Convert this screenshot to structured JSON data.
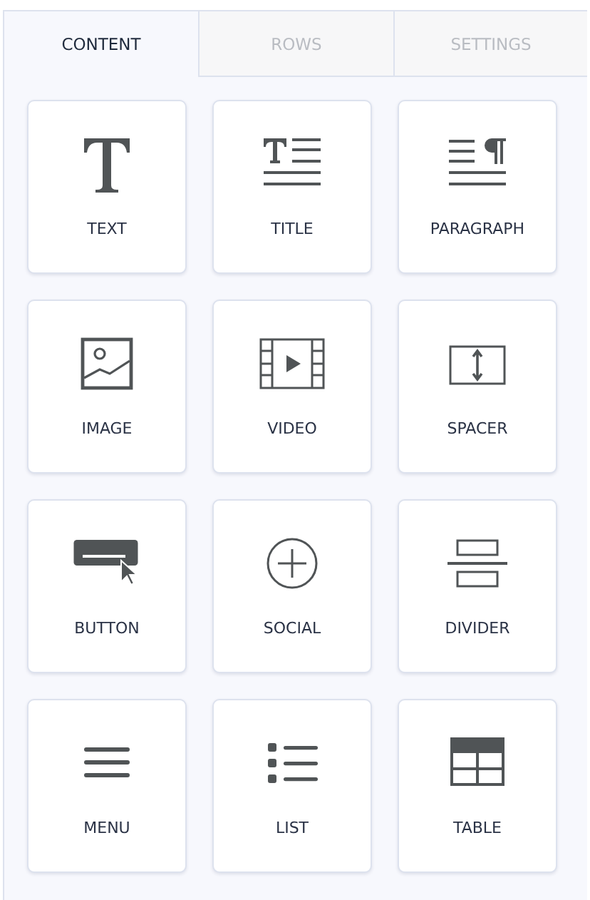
{
  "tabs": [
    {
      "label": "CONTENT",
      "selected": true
    },
    {
      "label": "ROWS",
      "selected": false
    },
    {
      "label": "SETTINGS",
      "selected": false
    }
  ],
  "blocks": [
    {
      "kind": "text",
      "label": "TEXT"
    },
    {
      "kind": "title",
      "label": "TITLE"
    },
    {
      "kind": "paragraph",
      "label": "PARAGRAPH"
    },
    {
      "kind": "image",
      "label": "IMAGE"
    },
    {
      "kind": "video",
      "label": "VIDEO"
    },
    {
      "kind": "spacer",
      "label": "SPACER"
    },
    {
      "kind": "button",
      "label": "BUTTON"
    },
    {
      "kind": "social",
      "label": "SOCIAL"
    },
    {
      "kind": "divider",
      "label": "DIVIDER"
    },
    {
      "kind": "menu",
      "label": "MENU"
    },
    {
      "kind": "list",
      "label": "LIST"
    },
    {
      "kind": "table",
      "label": "TABLE"
    }
  ]
}
